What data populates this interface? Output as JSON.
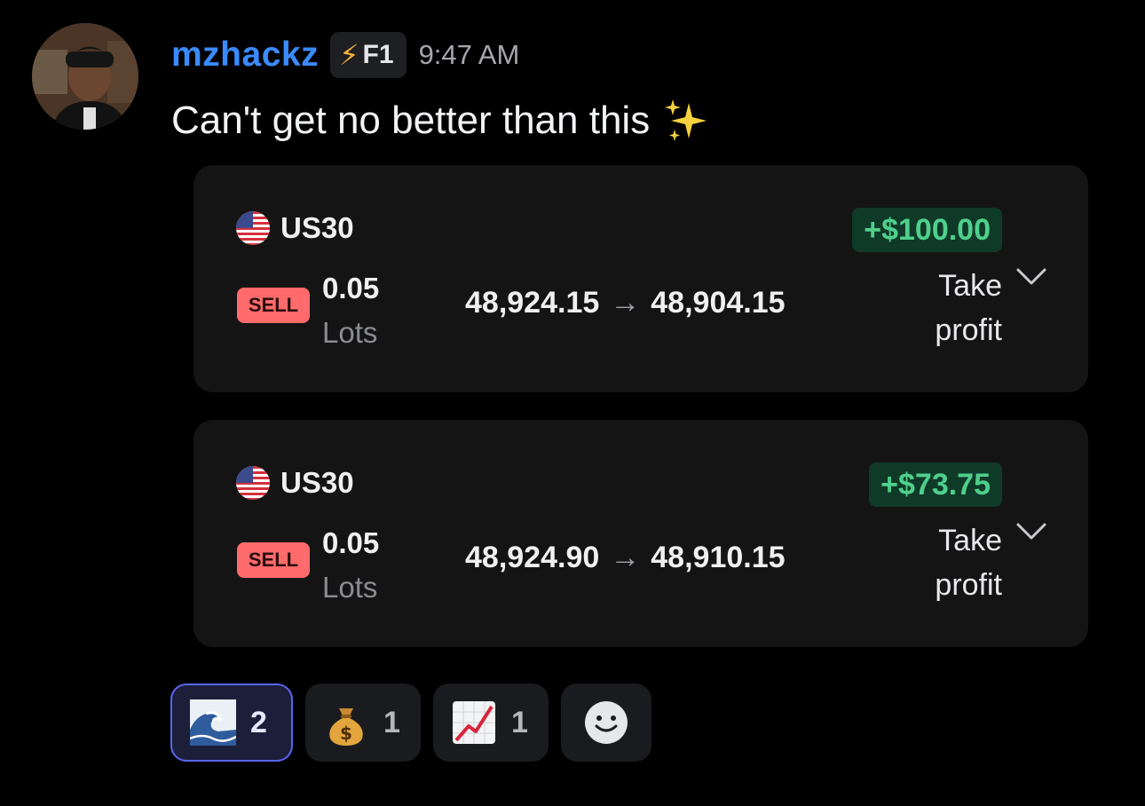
{
  "message": {
    "username": "mzhackz",
    "tag": {
      "icon": "lightning-bolt-icon",
      "label": "F1"
    },
    "timestamp": "9:47 AM",
    "text": "Can't get no better than this",
    "text_emoji": "sparkles-emoji"
  },
  "trades": [
    {
      "symbol": "US30",
      "flag": "us-flag-icon",
      "profit": "+$100.00",
      "side": "SELL",
      "lots_value": "0.05",
      "lots_unit": "Lots",
      "entry": "48,924.15",
      "exit": "48,904.15",
      "status_line1": "Take",
      "status_line2": "profit"
    },
    {
      "symbol": "US30",
      "flag": "us-flag-icon",
      "profit": "+$73.75",
      "side": "SELL",
      "lots_value": "0.05",
      "lots_unit": "Lots",
      "entry": "48,924.90",
      "exit": "48,910.15",
      "status_line1": "Take",
      "status_line2": "profit"
    }
  ],
  "reactions": [
    {
      "emoji": "wave-emoji",
      "count": "2",
      "reacted_by_me": true
    },
    {
      "emoji": "money-bag-emoji",
      "count": "1",
      "reacted_by_me": false
    },
    {
      "emoji": "chart-increasing-emoji",
      "count": "1",
      "reacted_by_me": false
    }
  ],
  "add_reaction": {
    "icon": "smiley-add-reaction-icon"
  },
  "colors": {
    "background": "#000000",
    "username": "#3a8bff",
    "profit_text": "#4fd08c",
    "profit_bg": "#0f3a28",
    "sell_badge": "#ff6b6b",
    "card_bg": "#141414",
    "reaction_active_border": "#5865f2"
  }
}
